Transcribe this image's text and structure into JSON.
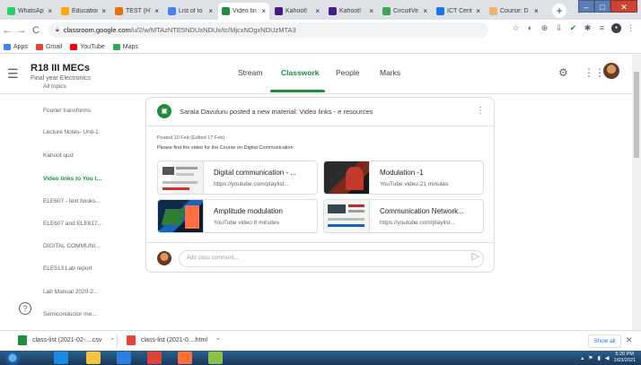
{
  "browser": {
    "tabs": [
      {
        "title": "WhatsApp",
        "color": "#25d366",
        "active": false
      },
      {
        "title": "Education",
        "color": "#f9ab00",
        "active": false
      },
      {
        "title": "TEST (HT",
        "color": "#e8710a",
        "active": false
      },
      {
        "title": "List of to",
        "color": "#4285f4",
        "active": false
      },
      {
        "title": "Video lin",
        "color": "#1e8e3e",
        "active": true
      },
      {
        "title": "Kahoot!",
        "color": "#46178f",
        "active": false
      },
      {
        "title": "Kahoot!",
        "color": "#46178f",
        "active": false
      },
      {
        "title": "CircuitVe",
        "color": "#34a853",
        "active": false
      },
      {
        "title": "ICT Cent",
        "color": "#1a73e8",
        "active": false
      },
      {
        "title": "Course: D",
        "color": "#f6b26b",
        "active": false
      }
    ],
    "new_tab_glyph": "+",
    "url_host": "classroom.google.com",
    "url_path": "/u/2/w/MTAzNTE5NDUxNDUx/tc/MjcxNDgxNDUzMTA3",
    "bookmarks": [
      {
        "label": "Apps",
        "color": "#4285f4"
      },
      {
        "label": "Gmail",
        "color": "#ea4335"
      },
      {
        "label": "YouTube",
        "color": "#ff0000"
      },
      {
        "label": "Maps",
        "color": "#34a853"
      }
    ]
  },
  "classroom": {
    "class_name": "R18 III MECs",
    "class_section": "Final year Electronics",
    "tabs": [
      "Stream",
      "Classwork",
      "People",
      "Marks"
    ],
    "active_tab": "Classwork",
    "topics": [
      "All topics",
      "Fourier transforms",
      "Lecture Notes- Unit-1",
      "Kahoot quiz",
      "Video links to You t...",
      "ELE607 - text books...",
      "ELE607 and ELE617...",
      "DIGITAL COMMUNI...",
      "ELE513 Lab report",
      "Lab Manual 2020-2...",
      "Semiconductor me..."
    ],
    "active_topic": "Video links to You t...",
    "post": {
      "title": "Sarala Davuluru posted a new material: Video links - e resources",
      "meta": "Posted 10 Feb (Edited 17 Feb)",
      "description": "Please find the video for the  Course on Digital Communication",
      "attachments": [
        {
          "title": "Digital communication - ...",
          "subtitle": "https://youtube.com/playlist..."
        },
        {
          "title": "Modulation -1",
          "subtitle": "YouTube video  21 minutes"
        },
        {
          "title": "Amplitude modulation",
          "subtitle": "YouTube video  8 minutes"
        },
        {
          "title": "Communication Network...",
          "subtitle": "https://youtube.com/playlist..."
        }
      ],
      "comment_placeholder": "Add class comment..."
    }
  },
  "downloads": {
    "items": [
      {
        "name": "class-list (2021-02-....csv",
        "color": "#1e8e3e"
      },
      {
        "name": "class-list (2021-0....html",
        "color": "#ea4335"
      }
    ],
    "show_all": "Show all"
  },
  "taskbar": {
    "apps": [
      {
        "name": "internet-explorer",
        "color": "#1e88e5"
      },
      {
        "name": "file-explorer",
        "color": "#f4c542"
      },
      {
        "name": "media-player",
        "color": "#2a7de1"
      },
      {
        "name": "chrome",
        "color": "#db4437"
      },
      {
        "name": "firefox",
        "color": "#ff7139"
      },
      {
        "name": "paint",
        "color": "#8bc34a"
      }
    ],
    "clock": "5:20 PM",
    "date": "1/03/2021"
  }
}
